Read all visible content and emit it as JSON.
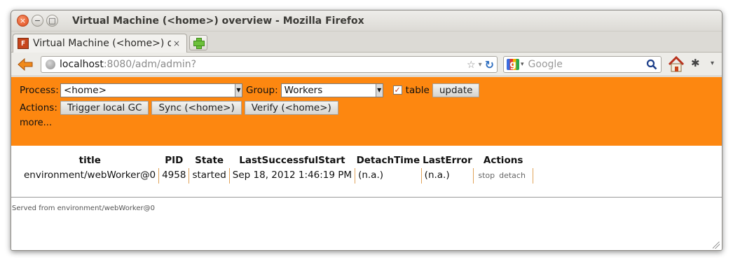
{
  "window": {
    "title": "Virtual Machine (<home>) overview - Mozilla Firefox",
    "close_glyph": "×",
    "min_glyph": "−",
    "max_glyph": "□"
  },
  "tabs": {
    "active_label": "Virtual Machine (<home>) ove...",
    "close_glyph": "×",
    "favicon_text": "F"
  },
  "nav": {
    "url_host": "localhost",
    "url_path": ":8080/adm/admin?",
    "search_placeholder": "Google",
    "star_glyph": "☆",
    "dropdown_glyph": "▾",
    "reload_glyph": "↻",
    "g_glyph": "g",
    "bug_glyph": "✱"
  },
  "controls": {
    "process_label": "Process:",
    "process_value": "<home>",
    "group_label": "Group:",
    "group_value": "Workers",
    "table_checked_glyph": "✓",
    "table_label": "table",
    "update_button": "update",
    "actions_label": "Actions:",
    "action_buttons": [
      "Trigger local GC",
      "Sync (<home>)",
      "Verify (<home>)"
    ],
    "more_link": "more...",
    "select_arrow": "▼"
  },
  "table": {
    "headers": [
      "title",
      "PID",
      "State",
      "LastSuccessfulStart",
      "DetachTime",
      "LastError",
      "Actions"
    ],
    "rows": [
      {
        "title": "environment/webWorker@0",
        "pid": "4958",
        "state": "started",
        "last_successful_start": "Sep 18, 2012 1:46:19 PM",
        "detach_time": "(n.a.)",
        "last_error": "(n.a.)",
        "actions": [
          "stop",
          "detach"
        ]
      }
    ]
  },
  "footer": {
    "text": "Served from environment/webWorker@0"
  },
  "colors": {
    "accent_orange": "#fd8710",
    "cell_separator": "#e0a35a"
  }
}
